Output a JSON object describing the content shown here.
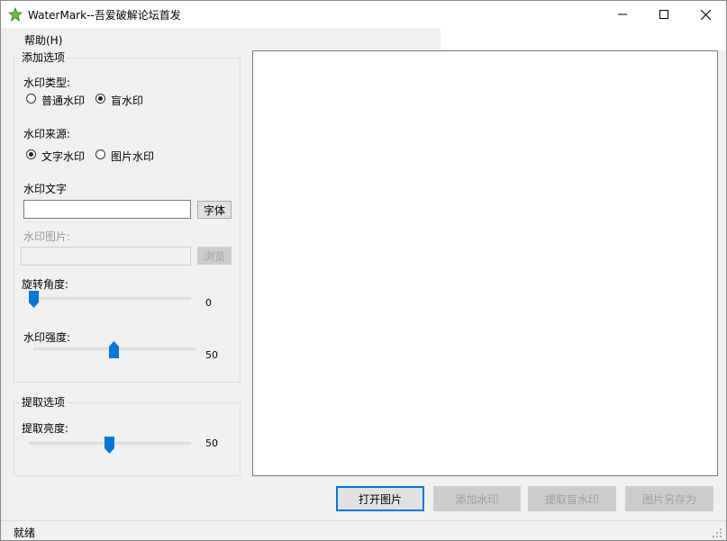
{
  "window": {
    "title": "WaterMark--吾爱破解论坛首发"
  },
  "window_controls": {
    "minimize": "minimize-icon",
    "maximize": "maximize-icon",
    "close": "close-icon"
  },
  "menu": {
    "help": "帮助(H)"
  },
  "add_options": {
    "legend": "添加选项",
    "type_label": "水印类型:",
    "type_options": [
      {
        "label": "普通水印",
        "selected": false
      },
      {
        "label": "盲水印",
        "selected": true
      }
    ],
    "source_label": "水印来源:",
    "source_options": [
      {
        "label": "文字水印",
        "selected": true
      },
      {
        "label": "图片水印",
        "selected": false
      }
    ],
    "text_label": "水印文字",
    "text_value": "",
    "font_button": "字体",
    "image_label": "水印图片:",
    "image_value": "",
    "browse_button": "浏览",
    "rotation_label": "旋转角度:",
    "rotation_value": "0",
    "strength_label": "水印强度:",
    "strength_value": "50"
  },
  "extract_options": {
    "legend": "提取选项",
    "brightness_label": "提取亮度:",
    "brightness_value": "50"
  },
  "actions": {
    "open": "打开图片",
    "add": "添加水印",
    "extract": "提取盲水印",
    "save_as": "图片另存为"
  },
  "status": {
    "text": "就绪"
  },
  "colors": {
    "accent": "#0078d7",
    "window_bg": "#f0f0f0"
  }
}
